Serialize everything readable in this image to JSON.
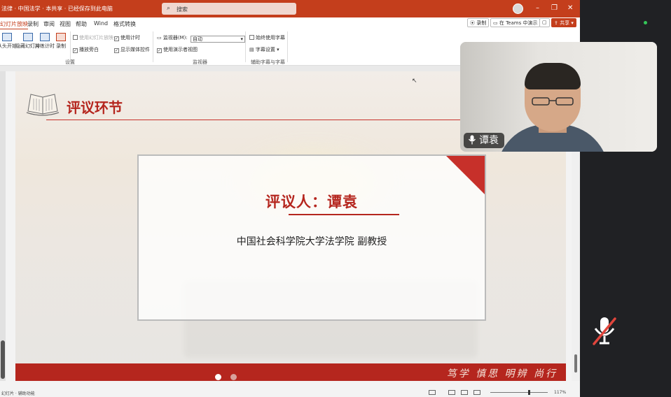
{
  "titlebar": {
    "doc_title": "法律 · 中国法学 · 本共享 · 已经保存到此电脑",
    "search_placeholder": "搜索",
    "minimize": "–",
    "restore": "❐",
    "close": "✕"
  },
  "menubar": {
    "tabs": [
      "幻灯片放映",
      "录制",
      "审阅",
      "视图",
      "帮助",
      "Wind",
      "格式转换"
    ],
    "record_label": "录制",
    "teams_label": "在 Teams 中演示",
    "share_label": "共享"
  },
  "ribbon": {
    "buttons": [
      {
        "label": "从头开始"
      },
      {
        "label": "隐藏幻灯片"
      },
      {
        "label": "排练计时"
      },
      {
        "label": "录制"
      }
    ],
    "checks": [
      {
        "label": "使用幻灯片放映",
        "checked": false,
        "dim": true
      },
      {
        "label": "使用计时",
        "checked": true,
        "dim": false
      },
      {
        "label": "播放旁白",
        "checked": true,
        "dim": false
      },
      {
        "label": "显示媒体控件",
        "checked": true,
        "dim": false
      },
      {
        "label": "使用演示者视图",
        "checked": true,
        "dim": false
      },
      {
        "label": "始终使用字幕",
        "checked": false,
        "dim": false
      }
    ],
    "monitor_label": "监视器(M):",
    "monitor_value": "自动",
    "subtitle_settings": "字幕设置",
    "groups": [
      "设置",
      "监视器",
      "辅助字幕与字幕"
    ]
  },
  "slide": {
    "heading": "评议环节",
    "reviewer": "评议人：谭袁",
    "affiliation": "中国社会科学院大学法学院 副教授",
    "motto": "笃学 慎思  明辨 尚行"
  },
  "pager": {
    "active_color": "#ffffff",
    "inactive_color": "#d8a29c"
  },
  "video": {
    "participant_name": "谭袁"
  },
  "statusbar": {
    "left": "幻灯片 · 辅助功能",
    "zoom": "117%"
  },
  "colors": {
    "brand": "#c43e1c",
    "slide_red": "#b5261e",
    "mute_red": "#e0453c"
  }
}
